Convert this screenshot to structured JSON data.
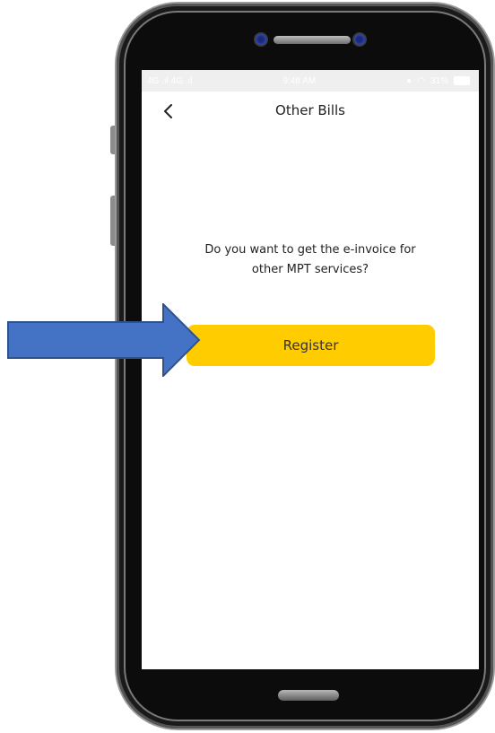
{
  "status_bar": {
    "network_left": "4G .ıl  4G .ıl",
    "time": "9:48 AM",
    "battery_text": "31%"
  },
  "header": {
    "back_icon": "chevron-left-icon",
    "title": "Other Bills"
  },
  "body": {
    "question_line1": "Do you want to get the e-invoice for",
    "question_line2": "other MPT services?"
  },
  "actions": {
    "register_label": "Register"
  },
  "colors": {
    "accent": "#ffcc00",
    "annotation_arrow": "#4472c4",
    "annotation_arrow_border": "#2f528f"
  }
}
